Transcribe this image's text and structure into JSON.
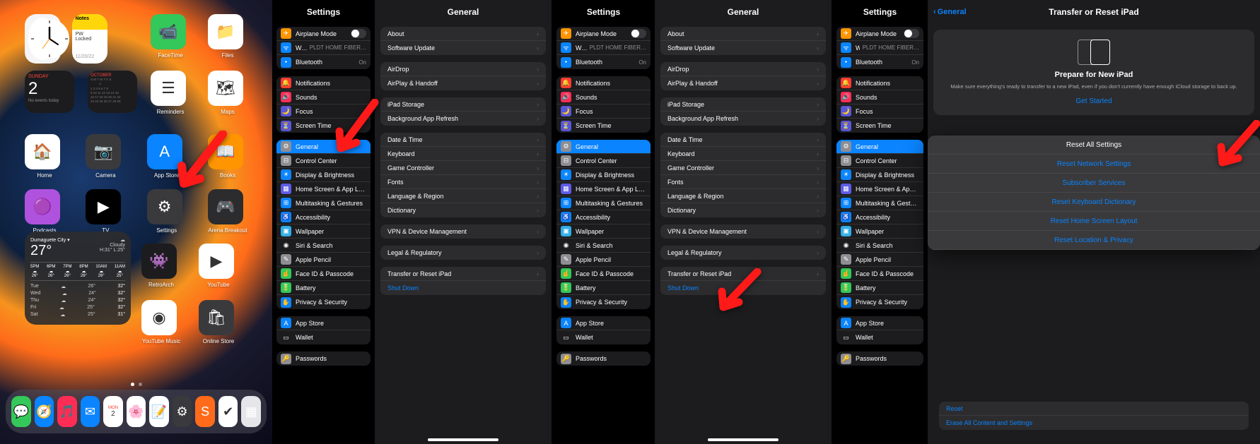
{
  "homescreen": {
    "date_label": "SUNDAY",
    "date_num": "2",
    "date_subtitle": "No events today",
    "date_full": "11/20/22",
    "month": "OCTOBER",
    "notes_title": "Notes",
    "notes_line1": "PW",
    "notes_line2": "Locked",
    "apps_row1": [
      {
        "label": "FaceTime",
        "bg": "#34c759",
        "emoji": "📹"
      },
      {
        "label": "Files",
        "bg": "#ffffff",
        "emoji": "📁"
      }
    ],
    "apps_row2": [
      {
        "label": "Reminders",
        "bg": "#ffffff",
        "emoji": "☰"
      },
      {
        "label": "Maps",
        "bg": "#ffffff",
        "emoji": "🗺"
      }
    ],
    "apps_row3": [
      {
        "label": "Home",
        "bg": "#ffffff",
        "emoji": "🏠"
      },
      {
        "label": "Camera",
        "bg": "#3a3a3c",
        "emoji": "📷"
      },
      {
        "label": "App Store",
        "bg": "#0a84ff",
        "emoji": "A"
      },
      {
        "label": "Books",
        "bg": "#ff9500",
        "emoji": "📖"
      }
    ],
    "apps_row4": [
      {
        "label": "Podcasts",
        "bg": "#af52de",
        "emoji": "🟣"
      },
      {
        "label": "TV",
        "bg": "#000000",
        "emoji": "▶"
      },
      {
        "label": "Settings",
        "bg": "#3a3a3c",
        "emoji": "⚙"
      },
      {
        "label": "Arena Breakout",
        "bg": "#2c2c2e",
        "emoji": "🎮"
      }
    ],
    "apps_row5": [
      {
        "label": "RetroArch",
        "bg": "#1c1c1e",
        "emoji": "👾"
      },
      {
        "label": "YouTube",
        "bg": "#ffffff",
        "emoji": "▶"
      }
    ],
    "apps_row6": [
      {
        "label": "YouTube Music",
        "bg": "#ffffff",
        "emoji": "◉"
      },
      {
        "label": "Online Store",
        "bg": "#3a3a3c",
        "emoji": "🛍"
      }
    ],
    "weather": {
      "city": "Dumaguete City ▾",
      "temp": "27°",
      "cond": "Cloudy",
      "hl": "H:31° L:25°",
      "hourly": [
        {
          "t": "5PM",
          "d": "26°"
        },
        {
          "t": "6PM",
          "d": "26°"
        },
        {
          "t": "7PM",
          "d": "26°"
        },
        {
          "t": "8PM",
          "d": "26°"
        },
        {
          "t": "10AM",
          "d": "26°"
        },
        {
          "t": "11AM",
          "d": "25°"
        }
      ],
      "daily": [
        {
          "d": "Tue",
          "l": "26°",
          "h": "32°"
        },
        {
          "d": "Wed",
          "l": "24°",
          "h": "32°"
        },
        {
          "d": "Thu",
          "l": "24°",
          "h": "32°"
        },
        {
          "d": "Fri",
          "l": "25°",
          "h": "32°"
        },
        {
          "d": "Sat",
          "l": "25°",
          "h": "31°"
        }
      ]
    },
    "dock": [
      {
        "bg": "#34c759",
        "emoji": "💬"
      },
      {
        "bg": "#0a84ff",
        "emoji": "🧭"
      },
      {
        "bg": "#ff2d55",
        "emoji": "🎵"
      },
      {
        "bg": "#0a84ff",
        "emoji": "✉"
      },
      {
        "bg": "#ffffff",
        "emoji": "2",
        "label": "MON"
      },
      {
        "bg": "#ffffff",
        "emoji": "🌸"
      },
      {
        "bg": "#ffffff",
        "emoji": "📝"
      },
      {
        "bg": "#3a3a3c",
        "emoji": "⚙"
      },
      {
        "bg": "#ff6b1a",
        "emoji": "S"
      },
      {
        "bg": "#ffffff",
        "emoji": "✔"
      },
      {
        "bg": "#e5e5ea",
        "emoji": "▦"
      }
    ]
  },
  "settings": {
    "title": "Settings",
    "groups": [
      [
        {
          "icon": "✈",
          "bg": "ic-orange",
          "label": "Airplane Mode",
          "toggle": true
        },
        {
          "icon": "ᯤ",
          "bg": "ic-blue",
          "label": "Wi-Fi",
          "value": "PLDT HOME FIBER…"
        },
        {
          "icon": "᛭",
          "bg": "ic-blue",
          "label": "Bluetooth",
          "value": "On"
        }
      ],
      [
        {
          "icon": "🔔",
          "bg": "ic-red",
          "label": "Notifications"
        },
        {
          "icon": "🔊",
          "bg": "ic-pink",
          "label": "Sounds"
        },
        {
          "icon": "🌙",
          "bg": "ic-purple",
          "label": "Focus"
        },
        {
          "icon": "⏳",
          "bg": "ic-purple",
          "label": "Screen Time"
        }
      ],
      [
        {
          "icon": "⚙",
          "bg": "ic-gray",
          "label": "General",
          "selected": true
        },
        {
          "icon": "⊟",
          "bg": "ic-gray",
          "label": "Control Center"
        },
        {
          "icon": "☀",
          "bg": "ic-blue",
          "label": "Display & Brightness"
        },
        {
          "icon": "▦",
          "bg": "ic-indigo",
          "label": "Home Screen & App Library"
        },
        {
          "icon": "⊞",
          "bg": "ic-blue",
          "label": "Multitasking & Gestures"
        },
        {
          "icon": "♿",
          "bg": "ic-blue",
          "label": "Accessibility"
        },
        {
          "icon": "▣",
          "bg": "ic-teal",
          "label": "Wallpaper"
        },
        {
          "icon": "◉",
          "bg": "ic-black",
          "label": "Siri & Search"
        },
        {
          "icon": "✎",
          "bg": "ic-gray",
          "label": "Apple Pencil"
        },
        {
          "icon": "☝",
          "bg": "ic-green",
          "label": "Face ID & Passcode"
        },
        {
          "icon": "🔋",
          "bg": "ic-green",
          "label": "Battery"
        },
        {
          "icon": "✋",
          "bg": "ic-blue",
          "label": "Privacy & Security"
        }
      ],
      [
        {
          "icon": "A",
          "bg": "ic-blue",
          "label": "App Store"
        },
        {
          "icon": "▭",
          "bg": "ic-black",
          "label": "Wallet"
        }
      ],
      [
        {
          "icon": "🔑",
          "bg": "ic-gray",
          "label": "Passwords"
        }
      ]
    ]
  },
  "general_detail": {
    "title": "General",
    "groups": [
      [
        {
          "label": "About"
        },
        {
          "label": "Software Update"
        }
      ],
      [
        {
          "label": "AirDrop"
        },
        {
          "label": "AirPlay & Handoff"
        }
      ],
      [
        {
          "label": "iPad Storage"
        },
        {
          "label": "Background App Refresh"
        }
      ],
      [
        {
          "label": "Date & Time"
        },
        {
          "label": "Keyboard"
        },
        {
          "label": "Game Controller"
        },
        {
          "label": "Fonts"
        },
        {
          "label": "Language & Region"
        },
        {
          "label": "Dictionary"
        }
      ],
      [
        {
          "label": "VPN & Device Management"
        }
      ],
      [
        {
          "label": "Legal & Regulatory"
        }
      ],
      [
        {
          "label": "Transfer or Reset iPad"
        },
        {
          "label": "Shut Down",
          "link": true,
          "nochev": true
        }
      ]
    ]
  },
  "reset_pane": {
    "back": "General",
    "title": "Transfer or Reset iPad",
    "prepare_title": "Prepare for New iPad",
    "prepare_sub": "Make sure everything's ready to transfer to a new iPad, even if you don't currently have enough iCloud storage to back up.",
    "get_started": "Get Started",
    "popover": [
      {
        "label": "Reset All Settings",
        "plain": true
      },
      {
        "label": "Reset Network Settings"
      },
      {
        "label": "Subscriber Services"
      },
      {
        "label": "Reset Keyboard Dictionary"
      },
      {
        "label": "Reset Home Screen Layout"
      },
      {
        "label": "Reset Location & Privacy"
      }
    ],
    "bottom": [
      {
        "label": "Reset"
      },
      {
        "label": "Erase All Content and Settings"
      }
    ]
  }
}
